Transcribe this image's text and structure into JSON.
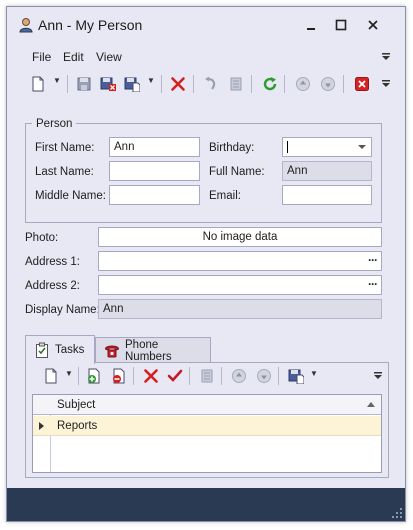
{
  "window": {
    "title": "Ann - My Person"
  },
  "menu": {
    "file": "File",
    "edit": "Edit",
    "view": "View"
  },
  "toolbar_icons": [
    "new-icon",
    "save-icon",
    "save-close-icon",
    "save-new-icon",
    "delete-icon",
    "undo-icon",
    "reset-icon",
    "refresh-icon",
    "previous-icon",
    "next-icon",
    "close-icon"
  ],
  "person": {
    "group_title": "Person",
    "first_name_label": "First Name:",
    "first_name_value": "Ann",
    "last_name_label": "Last Name:",
    "last_name_value": "",
    "middle_name_label": "Middle Name:",
    "middle_name_value": "",
    "birthday_label": "Birthday:",
    "birthday_value": "",
    "full_name_label": "Full Name:",
    "full_name_value": "Ann",
    "email_label": "Email:",
    "email_value": ""
  },
  "details": {
    "photo_label": "Photo:",
    "photo_value": "No image data",
    "address1_label": "Address 1:",
    "address1_value": "",
    "address2_label": "Address 2:",
    "address2_value": "",
    "display_name_label": "Display Name:",
    "display_name_value": "Ann",
    "ellipsis": "···"
  },
  "tabs": [
    {
      "label": "Tasks",
      "active": true
    },
    {
      "label": "Phone Numbers",
      "active": false
    }
  ],
  "grid": {
    "columns": [
      "Subject"
    ],
    "rows": [
      {
        "subject": "Reports"
      }
    ]
  },
  "colors": {
    "window_bg": "#e7e8f3",
    "statusbar": "#2a3a52",
    "selected_row": "#fdf4d8"
  }
}
